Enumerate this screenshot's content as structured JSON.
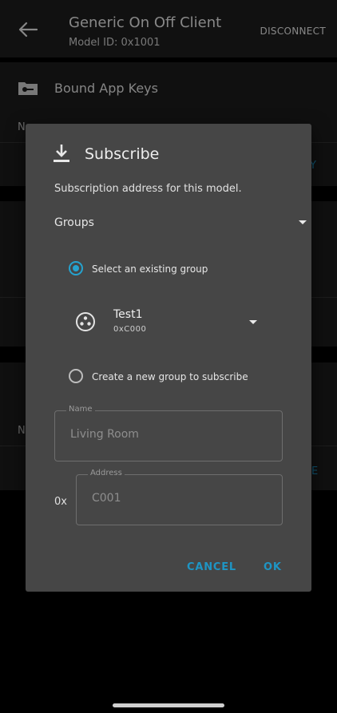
{
  "appbar": {
    "title": "Generic On Off Client",
    "subtitle": "Model ID: 0x1001",
    "disconnect_label": "DISCONNECT"
  },
  "background": {
    "bound_app_keys_label": "Bound App Keys",
    "peek_n": "N",
    "peek_y": "Y",
    "peek_n2": "N",
    "peek_e": "E"
  },
  "dialog": {
    "title": "Subscribe",
    "description": "Subscription address for this model.",
    "address_type": "Groups",
    "option_existing_label": "Select an existing group",
    "option_existing_selected": true,
    "group": {
      "name": "Test1",
      "address": "0xC000"
    },
    "option_new_label": "Create a new group to subscribe",
    "name_field": {
      "label": "Name",
      "placeholder": "Living Room"
    },
    "address_prefix": "0x",
    "address_field": {
      "label": "Address",
      "placeholder": "C001"
    },
    "cancel_label": "CANCEL",
    "ok_label": "OK"
  },
  "colors": {
    "accent": "#25a3cf",
    "dialog_bg": "#464646",
    "appbar_bg": "#1e1e1e"
  }
}
